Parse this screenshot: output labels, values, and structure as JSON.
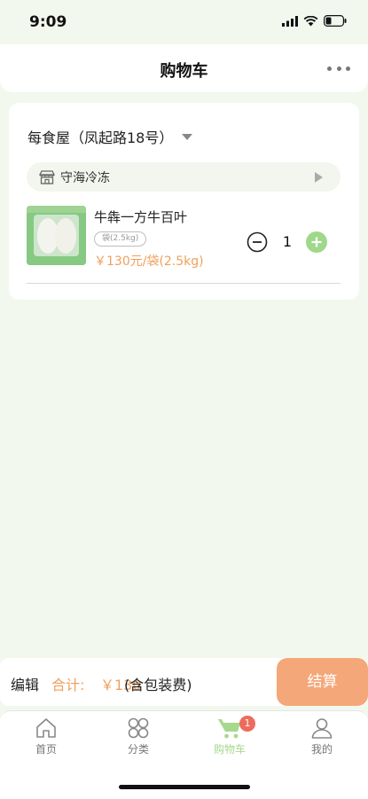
{
  "status_bar": {
    "time": "9:09"
  },
  "header": {
    "title": "购物车",
    "more_icon": "more-dots-icon"
  },
  "cart": {
    "store_name": "每食屋（凤起路18号）",
    "shop_name": "守海冷冻",
    "items": [
      {
        "name": "牛犇一方牛百叶",
        "spec": "袋(2.5kg)",
        "price": "￥130元/袋(2.5kg)",
        "quantity": "1"
      }
    ]
  },
  "checkout": {
    "edit_label": "编辑",
    "total_label": "合计:",
    "total_amount": "￥130",
    "total_note": "(含包装费)",
    "checkout_label": "结算"
  },
  "tabbar": {
    "tabs": [
      {
        "label": "首页",
        "icon": "home-icon"
      },
      {
        "label": "分类",
        "icon": "category-icon"
      },
      {
        "label": "购物车",
        "icon": "cart-icon",
        "badge": "1",
        "active": true
      },
      {
        "label": "我的",
        "icon": "user-icon"
      }
    ]
  },
  "colors": {
    "accent_green": "#a6d98d",
    "price_orange": "#f0a05c",
    "checkout_orange": "#f4a778",
    "badge_red": "#ee6b5b",
    "background": "#f3f8ef"
  }
}
